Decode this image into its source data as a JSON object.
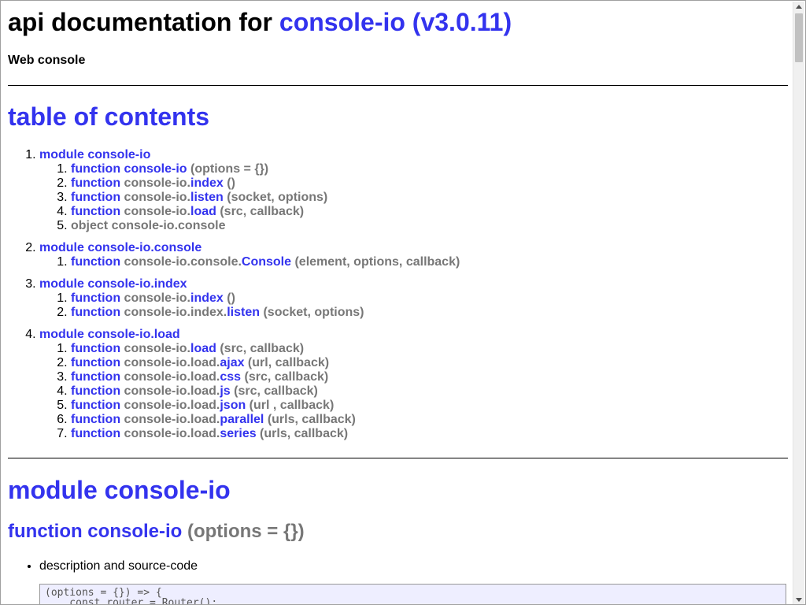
{
  "header": {
    "title_prefix": "api documentation for ",
    "title_link": "console-io (v3.0.11)",
    "subtitle": "Web console"
  },
  "toc": {
    "title": "table of contents",
    "modules": [
      {
        "label": "module console-io",
        "items": [
          {
            "kind": "function",
            "prefix": "",
            "name": "console-io",
            "args": " (options = {})"
          },
          {
            "kind": "function",
            "prefix": "console-io.",
            "name": "index",
            "args": " ()"
          },
          {
            "kind": "function",
            "prefix": "console-io.",
            "name": "listen",
            "args": " (socket, options)"
          },
          {
            "kind": "function",
            "prefix": "console-io.",
            "name": "load",
            "args": " (src, callback)"
          },
          {
            "kind": "object",
            "text": "object console-io.console"
          }
        ]
      },
      {
        "label": "module console-io.console",
        "items": [
          {
            "kind": "function",
            "prefix": "console-io.console.",
            "name": "Console",
            "args": " (element, options, callback)"
          }
        ]
      },
      {
        "label": "module console-io.index",
        "items": [
          {
            "kind": "function",
            "prefix": "console-io.",
            "name": "index",
            "args": " ()"
          },
          {
            "kind": "function",
            "prefix": "console-io.index.",
            "name": "listen",
            "args": " (socket, options)"
          }
        ]
      },
      {
        "label": "module console-io.load",
        "items": [
          {
            "kind": "function",
            "prefix": "console-io.",
            "name": "load",
            "args": " (src, callback)"
          },
          {
            "kind": "function",
            "prefix": "console-io.load.",
            "name": "ajax",
            "args": " (url, callback)"
          },
          {
            "kind": "function",
            "prefix": "console-io.load.",
            "name": "css",
            "args": " (src, callback)"
          },
          {
            "kind": "function",
            "prefix": "console-io.load.",
            "name": "js",
            "args": " (src, callback)"
          },
          {
            "kind": "function",
            "prefix": "console-io.load.",
            "name": "json",
            "args": " (url , callback)"
          },
          {
            "kind": "function",
            "prefix": "console-io.load.",
            "name": "parallel",
            "args": " (urls, callback)"
          },
          {
            "kind": "function",
            "prefix": "console-io.load.",
            "name": "series",
            "args": " (urls, callback)"
          }
        ]
      }
    ]
  },
  "function_keyword": "function",
  "section": {
    "module_title": "module console-io",
    "function_title": "function console-io",
    "function_args": " (options = {})",
    "desc_item": "description and source-code",
    "code": "(options = {}) => {\n    const router = Router();"
  },
  "colors": {
    "link": "#3333ee",
    "muted": "#777777",
    "code_bg": "#eeeeff"
  },
  "icons": {
    "scroll_up": "arrow-up-icon",
    "scroll_down": "arrow-down-icon"
  }
}
